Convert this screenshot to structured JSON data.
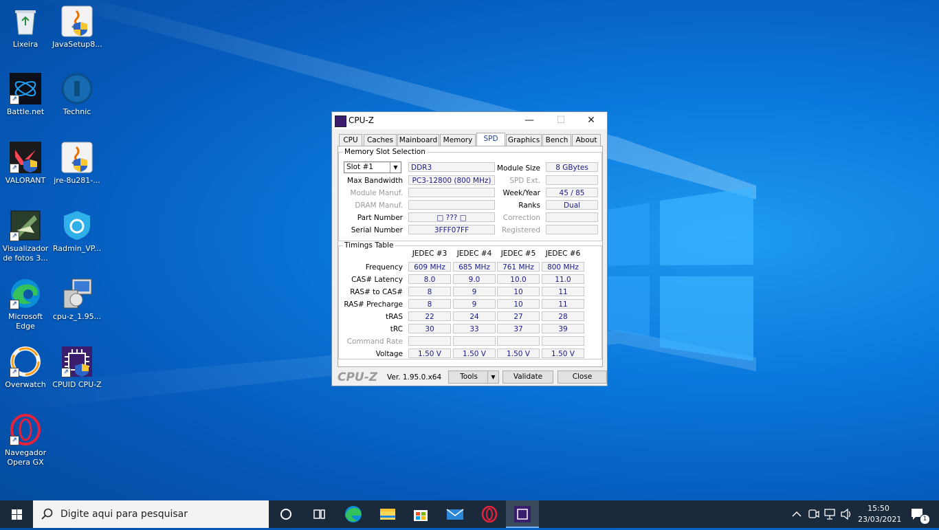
{
  "desktop": {
    "icons": [
      {
        "label": "Lixeira"
      },
      {
        "label": "JavaSetup8..."
      },
      {
        "label": "Battle.net"
      },
      {
        "label": "Technic"
      },
      {
        "label": "VALORANT"
      },
      {
        "label": "jre-8u281-..."
      },
      {
        "label": "Visualizador de fotos 3..."
      },
      {
        "label": "Radmin_VP..."
      },
      {
        "label": "Microsoft Edge"
      },
      {
        "label": "cpu-z_1.95..."
      },
      {
        "label": "Overwatch"
      },
      {
        "label": "CPUID CPU-Z"
      },
      {
        "label": "Navegador Opera GX"
      }
    ]
  },
  "window": {
    "title": "CPU-Z",
    "tabs": [
      "CPU",
      "Caches",
      "Mainboard",
      "Memory",
      "SPD",
      "Graphics",
      "Bench",
      "About"
    ],
    "active_tab": "SPD",
    "slot_section": {
      "legend": "Memory Slot Selection",
      "slot_value": "Slot #1",
      "type": "DDR3",
      "labels": {
        "max_bandwidth": "Max Bandwidth",
        "module_manuf": "Module Manuf.",
        "dram_manuf": "DRAM Manuf.",
        "part_number": "Part Number",
        "serial_number": "Serial Number",
        "module_size": "Module Size",
        "spd_ext": "SPD Ext.",
        "week_year": "Week/Year",
        "ranks": "Ranks",
        "correction": "Correction",
        "registered": "Registered"
      },
      "values": {
        "max_bandwidth": "PC3-12800 (800 MHz)",
        "module_manuf": "",
        "dram_manuf": "",
        "part_number": "□ ??? □",
        "serial_number": "3FFF07FF",
        "module_size": "8 GBytes",
        "spd_ext": "",
        "week_year": "45 / 85",
        "ranks": "Dual",
        "correction": "",
        "registered": ""
      }
    },
    "timings": {
      "legend": "Timings Table",
      "columns": [
        "JEDEC #3",
        "JEDEC #4",
        "JEDEC #5",
        "JEDEC #6"
      ],
      "rows": [
        {
          "label": "Frequency",
          "values": [
            "609 MHz",
            "685 MHz",
            "761 MHz",
            "800 MHz"
          ]
        },
        {
          "label": "CAS# Latency",
          "values": [
            "8.0",
            "9.0",
            "10.0",
            "11.0"
          ]
        },
        {
          "label": "RAS# to CAS#",
          "values": [
            "8",
            "9",
            "10",
            "11"
          ]
        },
        {
          "label": "RAS# Precharge",
          "values": [
            "8",
            "9",
            "10",
            "11"
          ]
        },
        {
          "label": "tRAS",
          "values": [
            "22",
            "24",
            "27",
            "28"
          ]
        },
        {
          "label": "tRC",
          "values": [
            "30",
            "33",
            "37",
            "39"
          ]
        },
        {
          "label": "Command Rate",
          "values": [
            "",
            "",
            "",
            ""
          ]
        },
        {
          "label": "Voltage",
          "values": [
            "1.50 V",
            "1.50 V",
            "1.50 V",
            "1.50 V"
          ]
        }
      ]
    },
    "footer": {
      "brand": "CPU-Z",
      "version": "Ver. 1.95.0.x64",
      "tools_label": "Tools",
      "validate_label": "Validate",
      "close_label": "Close"
    }
  },
  "taskbar": {
    "search_placeholder": "Digite aqui para pesquisar",
    "time": "15:50",
    "date": "23/03/2021",
    "notification_count": "1"
  },
  "colors": {
    "desktop_blue": "#0a78dc",
    "taskbar": "#1b2a3a",
    "value_text": "#1a1a8a"
  }
}
